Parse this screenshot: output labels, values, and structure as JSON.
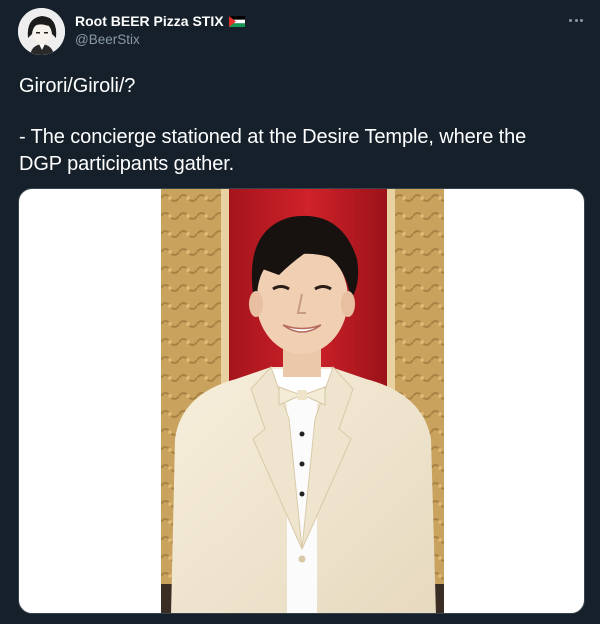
{
  "author": {
    "display_name": "Root BEER Pizza STIX",
    "handle": "@BeerStix",
    "avatar_icon": "anime-avatar-icon",
    "flag_icon": "palestine-flag-icon"
  },
  "tweet": {
    "line1": "Girori/Giroli/?",
    "line2": "- The concierge stationed at the Desire Temple, where the",
    "line3": "DGP participants gather."
  },
  "media": {
    "type": "photo",
    "icon": "photo-person-white-suit"
  },
  "more_icon": "more-dots-icon",
  "colors": {
    "background": "#15202b",
    "text": "#ffffff",
    "secondary": "#8899a6"
  }
}
